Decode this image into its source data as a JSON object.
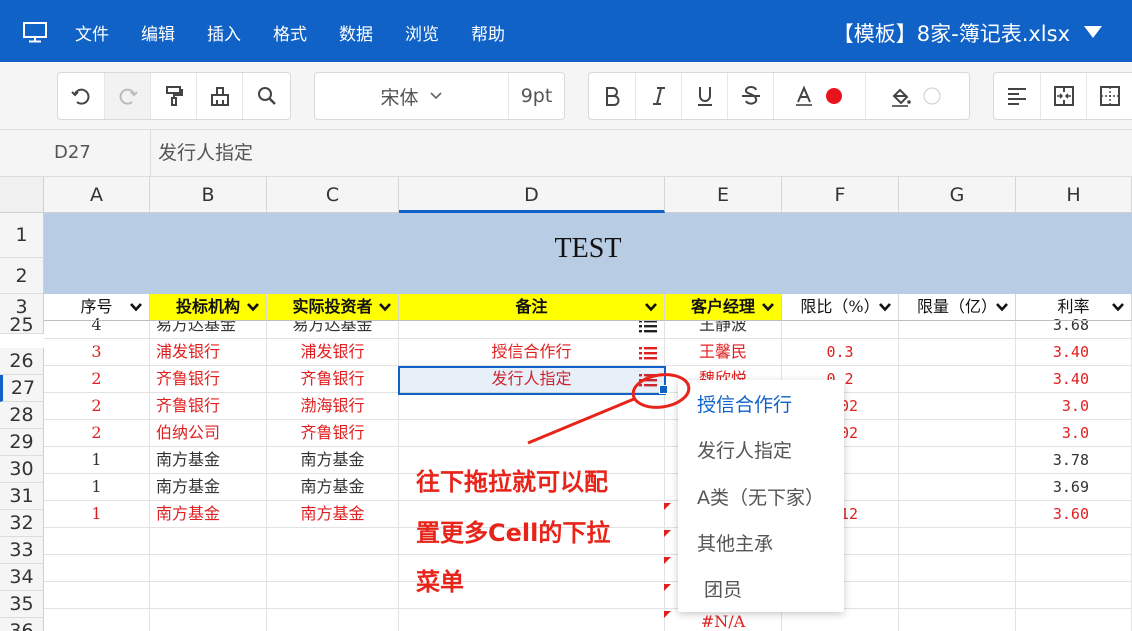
{
  "menubar": {
    "items": [
      "文件",
      "编辑",
      "插入",
      "格式",
      "数据",
      "浏览",
      "帮助"
    ],
    "doc_title": "【模板】8家-簿记表.xlsx"
  },
  "toolbar": {
    "font_name": "宋体",
    "font_size": "9pt",
    "font_color": "#e8141c",
    "fill_color": "#ffffff"
  },
  "formula_bar": {
    "cell_ref": "D27",
    "content": "发行人指定"
  },
  "columns": [
    "A",
    "B",
    "C",
    "D",
    "E",
    "F",
    "G",
    "H"
  ],
  "active_column": "D",
  "row_numbers": [
    "1",
    "2",
    "3",
    "25",
    "26",
    "27",
    "28",
    "29",
    "30",
    "31",
    "32",
    "33",
    "34",
    "35",
    "36"
  ],
  "active_row": "27",
  "title": "TEST",
  "header_row": [
    "序号",
    "投标机构",
    "实际投资者",
    "备注",
    "客户经理",
    "限比（%）",
    "限量（亿）",
    "利率"
  ],
  "rows": [
    {
      "a": "4",
      "b": "易方达基金",
      "c": "易方达基金",
      "d": "",
      "e": "王静波",
      "f": "",
      "g": "",
      "h": "3.68",
      "red": false
    },
    {
      "a": "3",
      "b": "浦发银行",
      "c": "浦发银行",
      "d": "授信合作行",
      "e": "王馨民",
      "f": "0.3",
      "g": "",
      "h": "3.40",
      "red": true
    },
    {
      "a": "2",
      "b": "齐鲁银行",
      "c": "齐鲁银行",
      "d": "发行人指定",
      "e": "魏欣悦",
      "f": "0.2",
      "g": "",
      "h": "3.40",
      "red": true
    },
    {
      "a": "2",
      "b": "齐鲁银行",
      "c": "渤海银行",
      "d": "",
      "e": "",
      "f": "0.02",
      "g": "",
      "h": "3.0",
      "red": true
    },
    {
      "a": "2",
      "b": "伯纳公司",
      "c": "齐鲁银行",
      "d": "",
      "e": "",
      "f": "0.02",
      "g": "",
      "h": "3.0",
      "red": true
    },
    {
      "a": "1",
      "b": "南方基金",
      "c": "南方基金",
      "d": "",
      "e": "",
      "f": "",
      "g": "",
      "h": "3.78",
      "red": false
    },
    {
      "a": "1",
      "b": "南方基金",
      "c": "南方基金",
      "d": "",
      "e": "",
      "f": "",
      "g": "",
      "h": "3.69",
      "red": false
    },
    {
      "a": "1",
      "b": "南方基金",
      "c": "南方基金",
      "d": "",
      "e": "",
      "f": "0.12",
      "g": "",
      "h": "3.60",
      "red": true
    },
    {
      "a": "",
      "b": "",
      "c": "",
      "d": "",
      "e": "",
      "f": "",
      "g": "",
      "h": "",
      "red": false
    },
    {
      "a": "",
      "b": "",
      "c": "",
      "d": "",
      "e": "",
      "f": "",
      "g": "",
      "h": "",
      "red": false
    },
    {
      "a": "",
      "b": "",
      "c": "",
      "d": "",
      "e": "",
      "f": "",
      "g": "",
      "h": "",
      "red": false
    },
    {
      "a": "",
      "b": "",
      "c": "",
      "d": "",
      "e": "#N/A",
      "f": "",
      "g": "",
      "h": "",
      "red": true
    }
  ],
  "dropdown": {
    "options": [
      "授信合作行",
      "发行人指定",
      "A类（无下家）",
      "其他主承",
      "团员"
    ],
    "selected": "授信合作行"
  },
  "annotation": {
    "lines": [
      "往下拖拉就可以配",
      "置更多Cell的下拉",
      "菜单"
    ],
    "color": "#e8241a"
  }
}
